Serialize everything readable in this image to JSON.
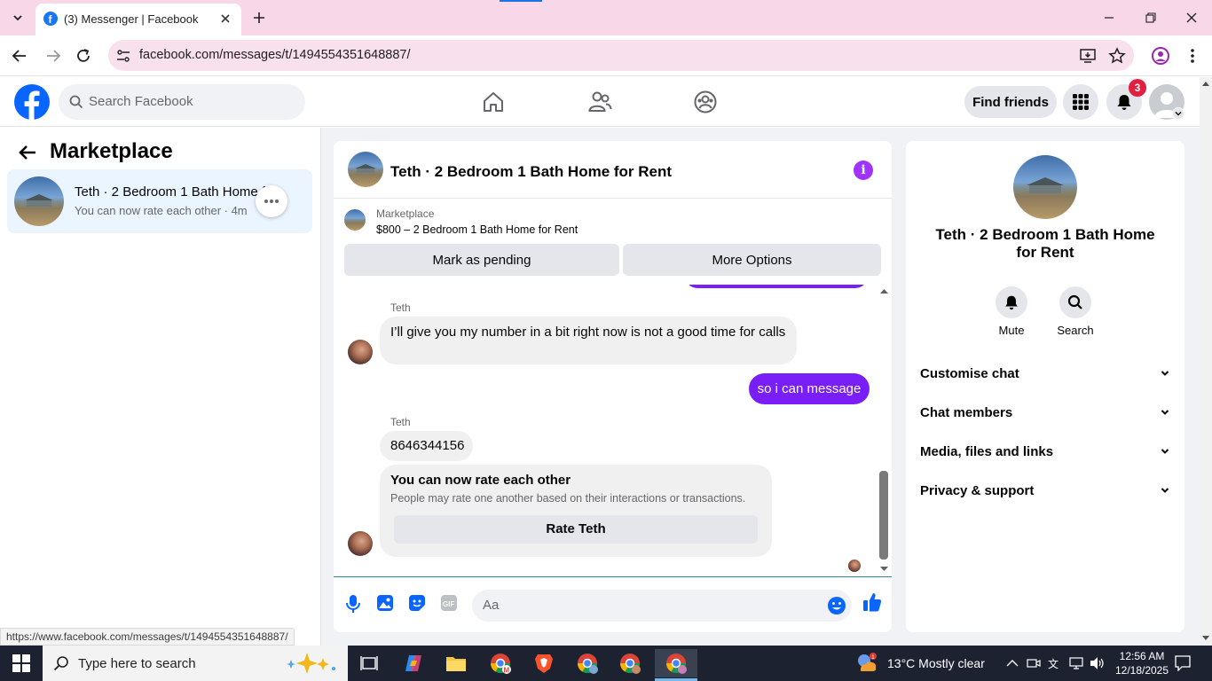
{
  "browser": {
    "tab_title": "(3) Messenger | Facebook",
    "url": "facebook.com/messages/t/1494554351648887/",
    "status_url": "https://www.facebook.com/messages/t/1494554351648887/"
  },
  "fb_header": {
    "search_placeholder": "Search Facebook",
    "find_friends": "Find friends",
    "notification_count": "3"
  },
  "sidebar": {
    "title": "Marketplace",
    "conversation": {
      "title": "Teth · 2 Bedroom 1 Bath Home f...",
      "subtitle": "You can now rate each other · 4m"
    }
  },
  "chat": {
    "title": "Teth · 2 Bedroom 1 Bath Home for Rent",
    "marketplace_label": "Marketplace",
    "listing": "$800 – 2 Bedroom 1 Bath Home for Rent",
    "mark_pending": "Mark as pending",
    "more_options": "More Options",
    "messages": [
      {
        "sender": "Teth",
        "text": "I’ll give you my number in a bit right now is not a good time for calls"
      },
      {
        "text": "so i can message"
      },
      {
        "sender": "Teth",
        "text": "8646344156"
      }
    ],
    "rate_card": {
      "title": "You can now rate each other",
      "subtitle": "People may rate one another based on their interactions or transactions.",
      "button": "Rate Teth"
    },
    "composer_placeholder": "Aa"
  },
  "info_panel": {
    "name": "Teth · 2 Bedroom 1 Bath Home for Rent",
    "mute": "Mute",
    "search": "Search",
    "sections": [
      "Customise chat",
      "Chat members",
      "Media, files and links",
      "Privacy & support"
    ]
  },
  "taskbar": {
    "search_placeholder": "Type here to search",
    "weather": "13°C  Mostly clear",
    "time": "12:56 AM",
    "date": "12/18/2025"
  },
  "colors": {
    "fb_blue": "#0866ff",
    "messenger_purple": "#7a1ef7",
    "notification_red": "#e41e3f"
  }
}
